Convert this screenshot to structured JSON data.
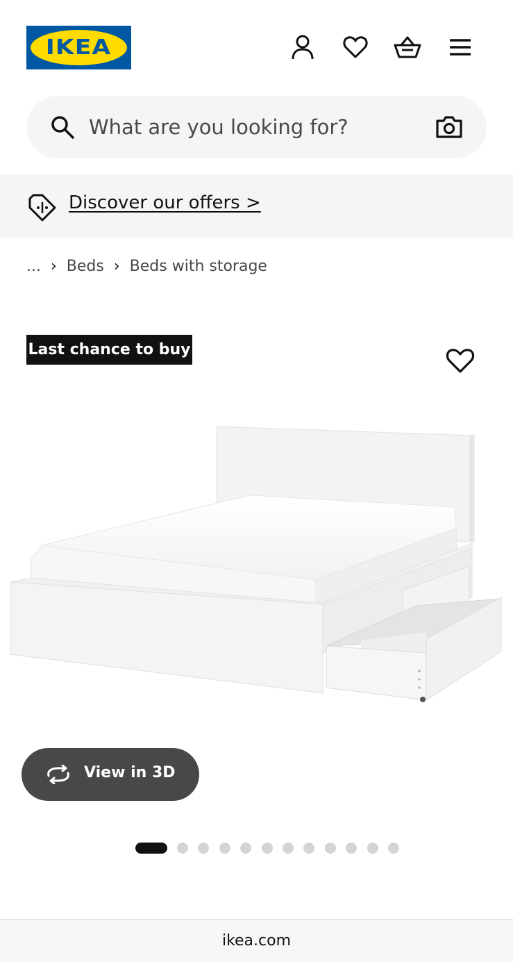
{
  "header": {
    "logo_text": "IKEA",
    "icons": [
      "profile-icon",
      "heart-icon",
      "basket-icon",
      "menu-icon"
    ]
  },
  "search": {
    "placeholder": "What are you looking for?",
    "icon": "search-icon",
    "camera_icon": "camera-icon"
  },
  "offers": {
    "link_text": "Discover our offers >",
    "icon": "price-tag-icon"
  },
  "breadcrumb": {
    "ellipsis": "...",
    "items": [
      "Beds",
      "Beds with storage"
    ]
  },
  "product": {
    "badge": "Last chance to buy",
    "favorite_icon": "heart-icon",
    "view3d_label": "View in 3D",
    "view3d_icon": "rotate-icon",
    "carousel_total": 12,
    "carousel_active": 1
  },
  "browser": {
    "url": "ikea.com"
  },
  "colors": {
    "ikea_blue": "#0058a3",
    "ikea_yellow": "#ffdb00",
    "badge_bg": "#111111",
    "view3d_bg": "#484848",
    "surface_gray": "#f5f5f5"
  }
}
